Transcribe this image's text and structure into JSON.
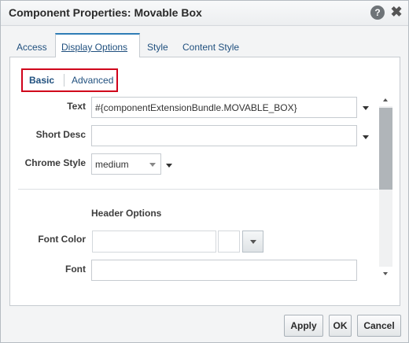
{
  "dialog": {
    "title": "Component Properties: Movable Box",
    "help_glyph": "?",
    "close_glyph": "✖"
  },
  "main_tabs": [
    {
      "label": "Access",
      "selected": false
    },
    {
      "label": "Display Options",
      "selected": true
    },
    {
      "label": "Style",
      "selected": false
    },
    {
      "label": "Content Style",
      "selected": false
    }
  ],
  "sub_tabs": [
    {
      "label": "Basic",
      "selected": true
    },
    {
      "label": "Advanced",
      "selected": false
    }
  ],
  "form": {
    "text_label": "Text",
    "text_value": "#{componentExtensionBundle.MOVABLE_BOX}",
    "short_desc_label": "Short Desc",
    "short_desc_value": "",
    "chrome_style_label": "Chrome Style",
    "chrome_style_value": "medium",
    "header_options_heading": "Header Options",
    "font_color_label": "Font Color",
    "font_color_value": "",
    "font_label": "Font",
    "font_value": ""
  },
  "buttons": {
    "apply": "Apply",
    "ok": "OK",
    "cancel": "Cancel"
  },
  "colors": {
    "accent": "#2f7db6",
    "highlight_border": "#d0021b",
    "link": "#1f4f7e"
  },
  "icons": [
    "help-icon",
    "close-icon",
    "dropdown-arrow-icon",
    "scroll-up-icon",
    "scroll-down-icon"
  ]
}
